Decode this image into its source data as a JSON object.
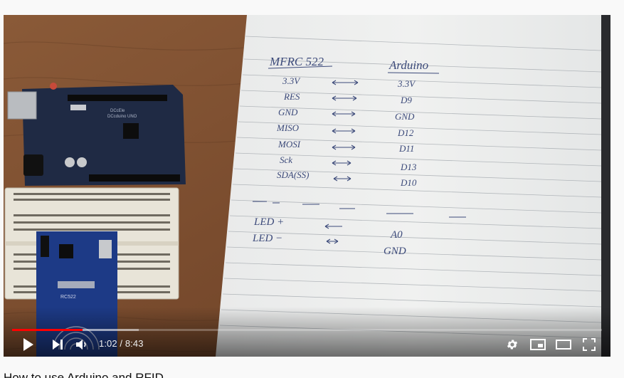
{
  "video": {
    "title": "How to use Arduino and RFID",
    "current_time": "1:02",
    "duration": "8:43",
    "progress_fraction": 0.119,
    "buffered_fraction": 0.215,
    "accent_color": "#ff0000"
  },
  "notes": {
    "header_left": "MFRC 522",
    "header_right": "Arduino",
    "rows": [
      {
        "left": "3.3V",
        "right": "3.3V"
      },
      {
        "left": "RES",
        "right": "D9"
      },
      {
        "left": "GND",
        "right": "GND"
      },
      {
        "left": "MISO",
        "right": "D12"
      },
      {
        "left": "MOSI",
        "right": "D11"
      },
      {
        "left": "Sck",
        "right": "D13"
      },
      {
        "left": "SDA(SS)",
        "right": "D10"
      }
    ],
    "led_rows": [
      {
        "left": "LED +",
        "right": "A0"
      },
      {
        "left": "LED −",
        "right": "GND"
      }
    ]
  },
  "board": {
    "label_1": "DCcEle",
    "label_2": "DCcduino UNO",
    "rfid_label": "RC522"
  },
  "icons": {
    "play": "play-icon",
    "next": "next-icon",
    "volume": "volume-icon",
    "settings": "gear-icon",
    "miniplayer": "miniplayer-icon",
    "theater": "theater-icon",
    "fullscreen": "fullscreen-icon"
  }
}
